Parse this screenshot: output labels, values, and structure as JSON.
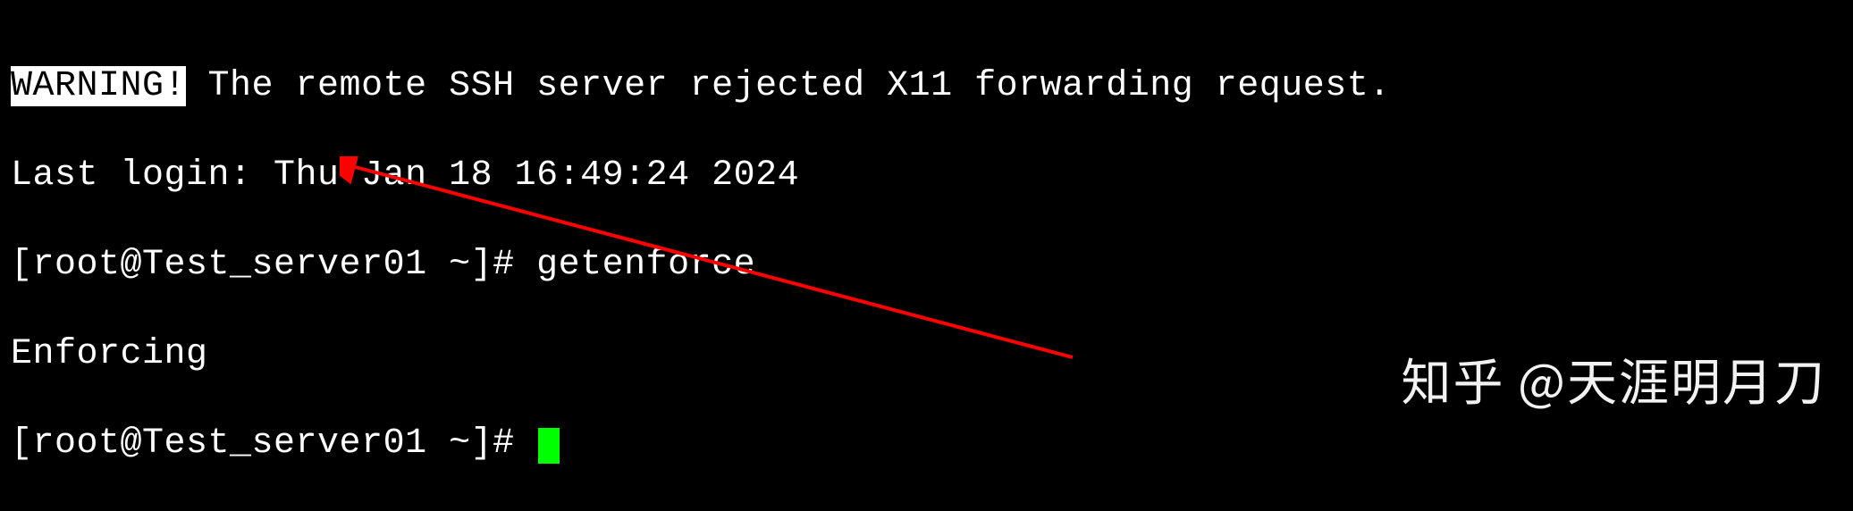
{
  "terminal": {
    "line1": {
      "warning": "WARNING!",
      "rest": " The remote SSH server rejected X11 forwarding request."
    },
    "line2": "Last login: Thu Jan 18 16:49:24 2024",
    "line3": {
      "prompt": "[root@Test_server01 ~]# ",
      "command": "getenforce"
    },
    "line4": "Enforcing",
    "line5": {
      "prompt": "[root@Test_server01 ~]# "
    }
  },
  "watermark": "知乎 @天涯明月刀"
}
